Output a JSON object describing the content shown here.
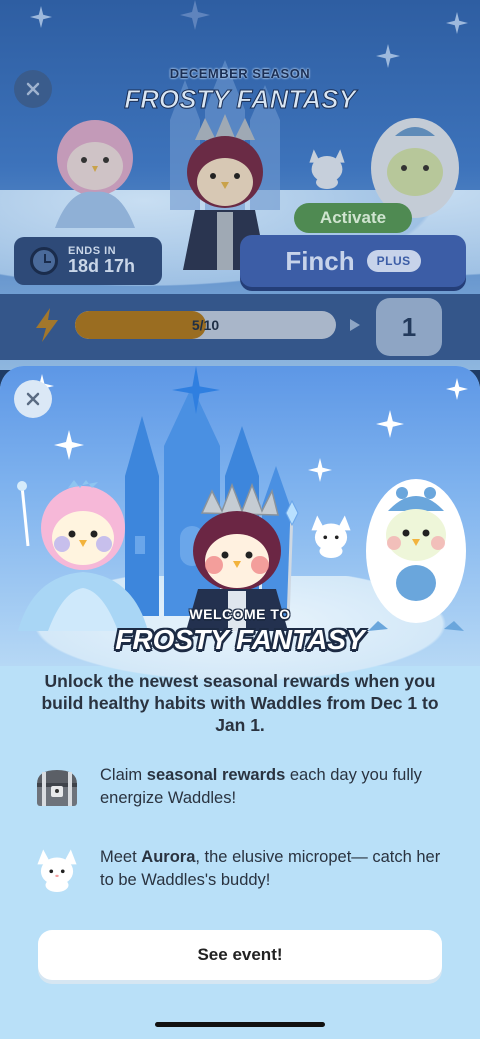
{
  "background_screen": {
    "season_label": "DECEMBER SEASON",
    "season_title": "FROSTY FANTASY",
    "ends_label": "ENDS IN",
    "ends_value": "18d 17h",
    "activate_label": "Activate",
    "finch_label": "Finch",
    "plus_badge": "PLUS",
    "progress_label": "5/10",
    "progress_fraction": 0.5,
    "level_value": "1"
  },
  "modal": {
    "welcome_label": "WELCOME TO",
    "title": "FROSTY FANTASY",
    "intro": "Unlock the newest seasonal rewards when you build healthy habits with Waddles from Dec 1 to Jan 1.",
    "features": [
      {
        "icon": "treasure-chest-icon",
        "prefix": "Claim ",
        "bold": "seasonal rewards",
        "suffix": " each day you fully energize Waddles!"
      },
      {
        "icon": "fox-micropet-icon",
        "prefix": "Meet ",
        "bold": "Aurora",
        "suffix": ", the elusive micropet— catch her to be Waddles's buddy!"
      }
    ],
    "cta_label": "See event!"
  },
  "colors": {
    "modal_bg": "#b9e0f8",
    "hero_sky": "#5d97e6",
    "activate_green": "#4f8a52",
    "finch_blue": "#3c5da6",
    "progress_fill": "#9a6d21"
  }
}
